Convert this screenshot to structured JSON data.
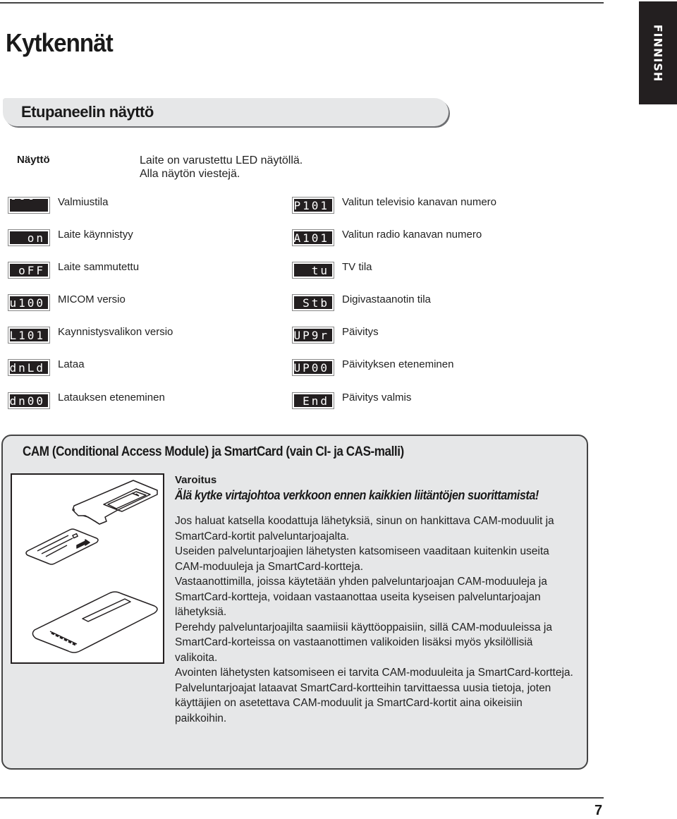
{
  "language_tab": "FINNISH",
  "page_title": "Kytkennät",
  "section_title": "Etupaneelin näyttö",
  "display": {
    "label": "Näyttö",
    "intro_lines": [
      "Laite on varustettu LED näytöllä.",
      "Alla näytön viestejä."
    ]
  },
  "led_left": [
    {
      "code": "----",
      "label": "Valmiustila"
    },
    {
      "code": "on",
      "label": "Laite käynnistyy"
    },
    {
      "code": "oFF",
      "label": "Laite sammutettu"
    },
    {
      "code": "u100",
      "label": "MICOM versio"
    },
    {
      "code": "L101",
      "label": "Kaynnistysvalikon versio"
    },
    {
      "code": "dnLd",
      "label": "Lataa"
    },
    {
      "code": "dn00",
      "label": "Latauksen eteneminen"
    }
  ],
  "led_right": [
    {
      "code": "P101",
      "label": "Valitun televisio kanavan numero"
    },
    {
      "code": "A101",
      "label": "Valitun radio kanavan numero"
    },
    {
      "code": "tu",
      "label": "TV tila"
    },
    {
      "code": "Stb",
      "label": "Digivastaanotin tila"
    },
    {
      "code": "UP9r",
      "label": "Päivitys"
    },
    {
      "code": "UP00",
      "label": "Päivityksen eteneminen"
    },
    {
      "code": "End",
      "label": "Päivitys valmis"
    }
  ],
  "cam": {
    "title": "CAM (Conditional Access Module) ja SmartCard (vain CI- ja CAS-malli)",
    "warning_label": "Varoitus",
    "warning_text": "Älä kytke virtajohtoa verkkoon ennen kaikkien liitäntöjen suorittamista!",
    "paragraphs": [
      "Jos haluat katsella koodattuja lähetyksiä, sinun on hankittava CAM-moduulit ja SmartCard-kortit palveluntarjoajalta.",
      "Useiden palveluntarjoajien lähetysten katsomiseen vaaditaan kuitenkin useita CAM-moduuleja ja SmartCard-kortteja.",
      "Vastaanottimilla, joissa käytetään yhden palveluntarjoajan CAM-moduuleja ja SmartCard-kortteja, voidaan vastaanottaa useita kyseisen palveluntarjoajan lähetyksiä.",
      "Perehdy palveluntarjoajilta saamiisii käyttöoppaisiin, sillä CAM-moduuleissa ja SmartCard-korteissa on vastaanottimen valikoiden lisäksi myös yksilöllisiä valikoita.",
      "Avointen lähetysten katsomiseen ei tarvita CAM-moduuleita ja SmartCard-kortteja.",
      "Palveluntarjoajat lataavat SmartCard-kortteihin tarvittaessa uusia tietoja, joten käyttäjien on asetettava CAM-moduulit ja SmartCard-kortit aina oikeisiin paikkoihin."
    ]
  },
  "page_number": "7"
}
